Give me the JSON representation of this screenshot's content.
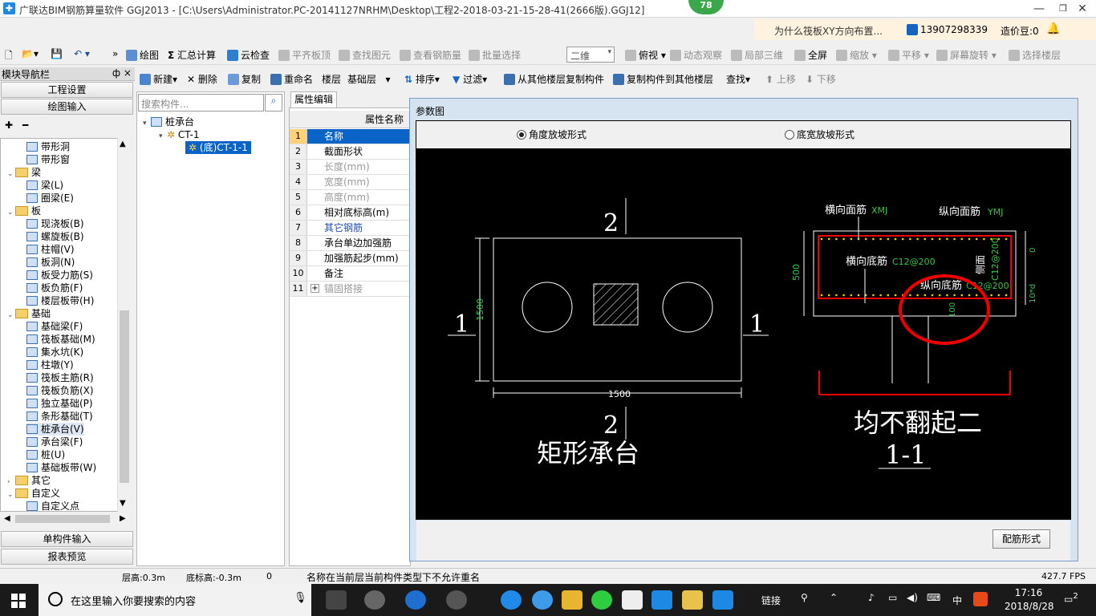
{
  "window": {
    "title": "广联达BIM钢筋算量软件 GGJ2013 - [C:\\Users\\Administrator.PC-20141127NRHM\\Desktop\\工程2-2018-03-21-15-28-41(2666版).GGJ12]",
    "badge": "78",
    "min": "—",
    "restore": "❐",
    "close": "✕"
  },
  "helpbar": {
    "question": "为什么筏板XY方向布置...",
    "phone": "13907298339",
    "beans": "造价豆:0"
  },
  "toolbar1": {
    "draw": "绘图",
    "sum": "汇总计算",
    "cloud": "云检查",
    "flat": "平齐板顶",
    "find": "查找图元",
    "view_rebar": "查看钢筋量",
    "batch": "批量选择",
    "dim": "二维",
    "plan": "俯视",
    "dyn": "动态观察",
    "local3d": "局部三维",
    "full": "全屏",
    "zoom": "缩放",
    "pan": "平移",
    "rotate": "屏幕旋转",
    "floor": "选择楼层"
  },
  "toolbar2": {
    "new": "新建",
    "delete": "删除",
    "copy": "复制",
    "rename": "重命名",
    "layer_label": "楼层",
    "layer": "基础层",
    "sort": "排序",
    "filter": "过滤",
    "copy_from": "从其他楼层复制构件",
    "copy_to": "复制构件到其他楼层",
    "search": "查找",
    "up": "上移",
    "down": "下移"
  },
  "nav": {
    "header": "模块导航栏",
    "pin": "ф ×",
    "project_settings": "工程设置",
    "draw_input": "绘图输入",
    "single_input": "单构件输入",
    "report": "报表预览"
  },
  "tree": [
    {
      "label": "带形洞",
      "type": "item"
    },
    {
      "label": "带形窗",
      "type": "item"
    },
    {
      "label": "梁",
      "type": "folder"
    },
    {
      "label": "梁(L)",
      "type": "item"
    },
    {
      "label": "圈梁(E)",
      "type": "item"
    },
    {
      "label": "板",
      "type": "folder"
    },
    {
      "label": "现浇板(B)",
      "type": "item"
    },
    {
      "label": "螺旋板(B)",
      "type": "item"
    },
    {
      "label": "柱帽(V)",
      "type": "item"
    },
    {
      "label": "板洞(N)",
      "type": "item"
    },
    {
      "label": "板受力筋(S)",
      "type": "item"
    },
    {
      "label": "板负筋(F)",
      "type": "item"
    },
    {
      "label": "楼层板带(H)",
      "type": "item"
    },
    {
      "label": "基础",
      "type": "folder"
    },
    {
      "label": "基础梁(F)",
      "type": "item"
    },
    {
      "label": "筏板基础(M)",
      "type": "item"
    },
    {
      "label": "集水坑(K)",
      "type": "item"
    },
    {
      "label": "柱墩(Y)",
      "type": "item"
    },
    {
      "label": "筏板主筋(R)",
      "type": "item"
    },
    {
      "label": "筏板负筋(X)",
      "type": "item"
    },
    {
      "label": "独立基础(P)",
      "type": "item"
    },
    {
      "label": "条形基础(T)",
      "type": "item"
    },
    {
      "label": "桩承台(V)",
      "type": "item",
      "selected": true
    },
    {
      "label": "承台梁(F)",
      "type": "item"
    },
    {
      "label": "桩(U)",
      "type": "item"
    },
    {
      "label": "基础板带(W)",
      "type": "item"
    },
    {
      "label": "其它",
      "type": "folder",
      "collapsed": true
    },
    {
      "label": "自定义",
      "type": "folder"
    },
    {
      "label": "自定义点",
      "type": "item"
    }
  ],
  "complist": {
    "search_placeholder": "搜索构件...",
    "root": "桩承台",
    "child": "CT-1",
    "leaf": "(底)CT-1-1"
  },
  "props": {
    "tab": "属性编辑",
    "header": "属性名称",
    "rows": [
      {
        "n": "1",
        "v": "名称",
        "style": "sel"
      },
      {
        "n": "2",
        "v": "截面形状",
        "style": ""
      },
      {
        "n": "3",
        "v": "长度(mm)",
        "style": "gray"
      },
      {
        "n": "4",
        "v": "宽度(mm)",
        "style": "gray"
      },
      {
        "n": "5",
        "v": "高度(mm)",
        "style": "gray"
      },
      {
        "n": "6",
        "v": "相对底标高(m)",
        "style": ""
      },
      {
        "n": "7",
        "v": "其它钢筋",
        "style": "blue"
      },
      {
        "n": "8",
        "v": "承台单边加强筋",
        "style": ""
      },
      {
        "n": "9",
        "v": "加强筋起步(mm)",
        "style": ""
      },
      {
        "n": "10",
        "v": "备注",
        "style": ""
      },
      {
        "n": "11",
        "v": "锚固搭接",
        "style": "gray",
        "expander": "+"
      }
    ]
  },
  "dialog": {
    "title": "参数图",
    "opt1": "角度放坡形式",
    "opt2": "底宽放坡形式",
    "config_button": "配筋形式"
  },
  "drawing": {
    "plan_top_label": "2",
    "plan_bottom_label": "2",
    "plan_left_label": "1",
    "plan_right_label": "1",
    "plan_width_dim": "1500",
    "plan_height_dim": "1500",
    "plan_caption": "矩形承台",
    "sec_top_h": "横向面筋",
    "sec_top_h_code": "XMJ",
    "sec_top_v": "纵向面筋",
    "sec_top_v_code": "YMJ",
    "sec_h_bottom": "横向底筋",
    "sec_h_bottom_code": "C12@200",
    "sec_v_bottom": "纵向底筋",
    "sec_v_bottom_code": "C12@200",
    "sec_side": "侧面",
    "sec_side_code": "C12@200",
    "sec_height": "500",
    "sec_cover": "100",
    "sec_top_dim": "0",
    "sec_side_dim": "10*d",
    "sec_caption": "均不翻起二",
    "sec_section": "1-1"
  },
  "status": {
    "floor_height": "层高:0.3m",
    "bottom_elev": "底标高:-0.3m",
    "zero": "0",
    "message": "名称在当前层当前构件类型下不允许重名",
    "fps": "427.7 FPS"
  },
  "taskbar": {
    "search": "在这里输入你要搜索的内容",
    "link": "链接",
    "lang": "中",
    "time": "17:16",
    "date": "2018/8/28",
    "notif": "2"
  }
}
